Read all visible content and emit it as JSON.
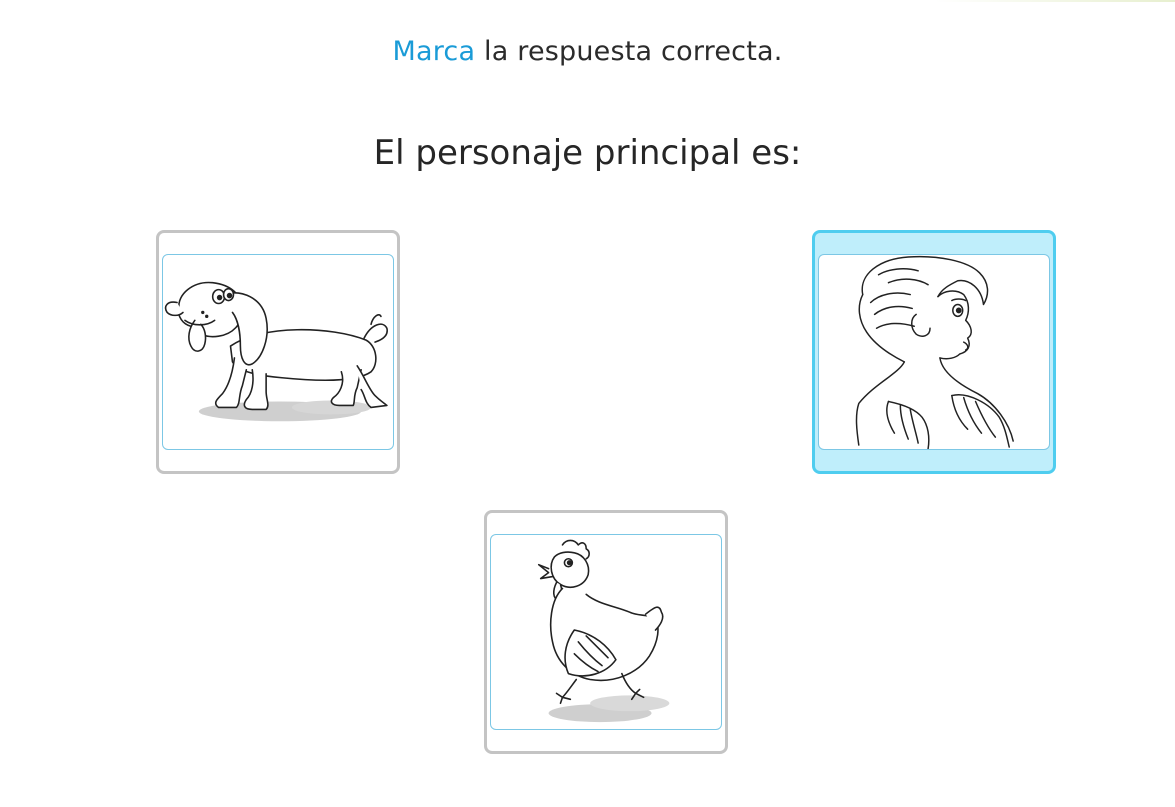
{
  "instruction": {
    "verb": "Marca",
    "rest": " la respuesta correcta."
  },
  "question": "El personaje principal es:",
  "options": [
    {
      "label": "perro",
      "icon": "dog-illustration",
      "selected": false
    },
    {
      "label": "niño con alas",
      "icon": "winged-boy-illustration",
      "selected": true
    },
    {
      "label": "gallina",
      "icon": "hen-illustration",
      "selected": false
    }
  ],
  "colors": {
    "accent": "#1a9bd7",
    "selected_border": "#4fcdef",
    "selected_fill": "#bfeefb",
    "frame": "#7cc7e5",
    "card_border": "#c4c4c4"
  }
}
